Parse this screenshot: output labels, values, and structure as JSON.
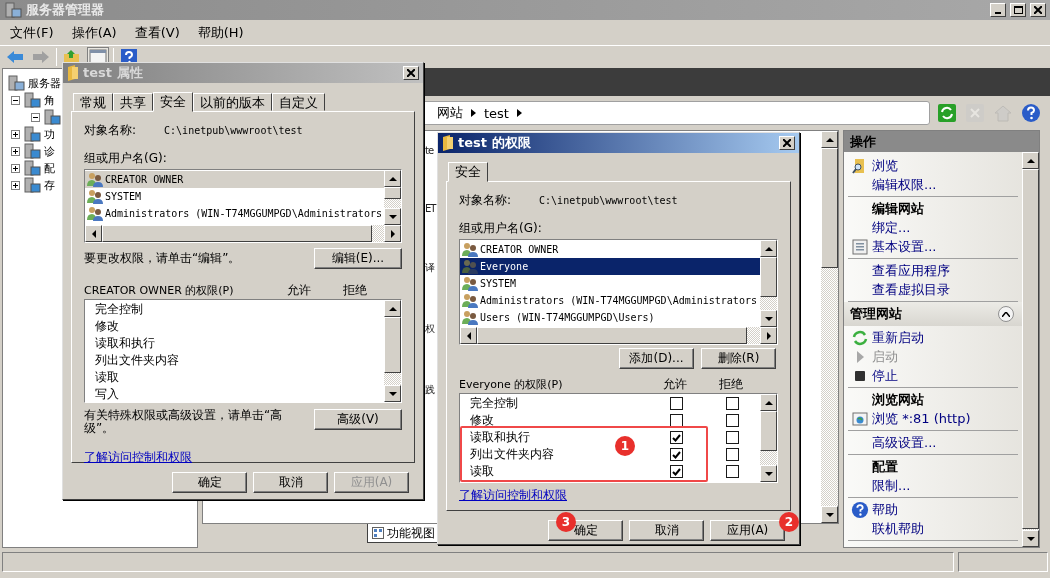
{
  "window": {
    "title": "服务器管理器"
  },
  "menu": [
    {
      "label": "文件(F)"
    },
    {
      "label": "操作(A)"
    },
    {
      "label": "查看(V)"
    },
    {
      "label": "帮助(H)"
    }
  ],
  "toolbar": {
    "back": {
      "disabled": false
    },
    "forward": {
      "disabled": true
    },
    "pane_toggle": {
      "pressed": true
    }
  },
  "tree": [
    {
      "label": "服务器",
      "children": [
        {
          "label": "角",
          "expanded": true,
          "children": [
            {
              "expanded": true
            }
          ]
        },
        {
          "label": "功",
          "expanded": false
        },
        {
          "label": "诊",
          "expanded": false
        },
        {
          "label": "配",
          "expanded": false
        },
        {
          "label": "存",
          "expanded": false
        }
      ]
    }
  ],
  "address_bar": {
    "crumbs": [
      "网站",
      "test"
    ]
  },
  "nav_tools": [
    {
      "kind": "refresh",
      "disabled": false
    },
    {
      "kind": "stop",
      "disabled": true
    },
    {
      "kind": "home",
      "disabled": true
    },
    {
      "kind": "help",
      "disabled": false
    }
  ],
  "center": {
    "fragments": [
      "te",
      "ET",
      "译",
      "权",
      "践"
    ],
    "view_tabs": [
      {
        "label": "功能视图",
        "selected": true
      }
    ]
  },
  "actions": {
    "title": "操作",
    "groups": [
      {
        "sections": [
          [
            {
              "kind": "browse",
              "label": "浏览",
              "disabled": false
            },
            {
              "kind": "link",
              "label": "编辑权限...",
              "disabled": false
            }
          ],
          [
            {
              "kind": "heading",
              "label": "编辑网站",
              "disabled": false
            },
            {
              "kind": "link",
              "label": "绑定...",
              "disabled": false
            },
            {
              "kind": "settings",
              "label": "基本设置...",
              "disabled": false
            }
          ],
          [
            {
              "kind": "link",
              "label": "查看应用程序",
              "disabled": false
            },
            {
              "kind": "link",
              "label": "查看虚拟目录",
              "disabled": false
            }
          ]
        ]
      },
      {
        "title": "管理网站",
        "expanded": true,
        "sections": [
          [
            {
              "kind": "restart",
              "label": "重新启动",
              "disabled": false
            },
            {
              "kind": "start",
              "label": "启动",
              "disabled": true
            },
            {
              "kind": "stop",
              "label": "停止",
              "disabled": false
            }
          ],
          [
            {
              "kind": "heading",
              "label": "浏览网站",
              "disabled": false
            },
            {
              "kind": "site",
              "label": "浏览 *:81 (http)",
              "disabled": false
            }
          ],
          [
            {
              "kind": "link",
              "label": "高级设置...",
              "disabled": false
            }
          ],
          [
            {
              "kind": "heading",
              "label": "配置",
              "disabled": false
            },
            {
              "kind": "link",
              "label": "限制...",
              "disabled": false
            }
          ],
          [
            {
              "kind": "help",
              "label": "帮助",
              "disabled": false
            },
            {
              "kind": "link",
              "label": "联机帮助",
              "disabled": false
            }
          ]
        ]
      }
    ]
  },
  "dialogs": [
    {
      "title": "test 属性",
      "active": false,
      "tabs": [
        {
          "label": "常规",
          "selected": false
        },
        {
          "label": "共享",
          "selected": false
        },
        {
          "label": "安全",
          "selected": true
        },
        {
          "label": "以前的版本",
          "selected": false
        },
        {
          "label": "自定义",
          "selected": false
        }
      ],
      "object_label": "对象名称:",
      "object_name": "C:\\inetpub\\wwwroot\\test",
      "users_label": "组或用户名(G):",
      "users": [
        {
          "name": "CREATOR OWNER",
          "selected": true
        },
        {
          "name": "SYSTEM",
          "selected": false
        },
        {
          "name": "Administrators (WIN-T74MGGUMPGD\\Administrators",
          "selected": false
        }
      ],
      "edit_row": {
        "text": "要更改权限，请单击“编辑”。",
        "button": "编辑(E)..."
      },
      "permissions_label": "CREATOR OWNER 的权限(P)",
      "allow_label": "允许",
      "deny_label": "拒绝",
      "permissions": [
        {
          "name": "完全控制"
        },
        {
          "name": "修改"
        },
        {
          "name": "读取和执行"
        },
        {
          "name": "列出文件夹内容"
        },
        {
          "name": "读取"
        },
        {
          "name": "写入"
        }
      ],
      "advanced_row": {
        "text": "有关特殊权限或高级设置，请单击“高级”。",
        "button": "高级(V)"
      },
      "link": "了解访问控制和权限",
      "buttons": [
        {
          "label": "确定",
          "disabled": false
        },
        {
          "label": "取消",
          "disabled": false
        },
        {
          "label": "应用(A)",
          "disabled": true
        }
      ]
    },
    {
      "title": "test 的权限",
      "active": true,
      "tabs": [
        {
          "label": "安全",
          "selected": true
        }
      ],
      "object_label": "对象名称:",
      "object_name": "C:\\inetpub\\wwwroot\\test",
      "users_label": "组或用户名(G):",
      "users": [
        {
          "name": "CREATOR OWNER",
          "selected": false
        },
        {
          "name": "Everyone",
          "selected": true
        },
        {
          "name": "SYSTEM",
          "selected": false
        },
        {
          "name": "Administrators (WIN-T74MGGUMPGD\\Administrators",
          "selected": false
        },
        {
          "name": "Users (WIN-T74MGGUMPGD\\Users)",
          "selected": false
        }
      ],
      "list_buttons": [
        {
          "label": "添加(D)..."
        },
        {
          "label": "删除(R)"
        }
      ],
      "permissions_label": "Everyone 的权限(P)",
      "allow_label": "允许",
      "deny_label": "拒绝",
      "permissions": [
        {
          "name": "完全控制",
          "allow": false,
          "deny": false
        },
        {
          "name": "修改",
          "allow": false,
          "deny": false
        },
        {
          "name": "读取和执行",
          "allow": true,
          "deny": false
        },
        {
          "name": "列出文件夹内容",
          "allow": true,
          "deny": false
        },
        {
          "name": "读取",
          "allow": true,
          "deny": false
        }
      ],
      "link": "了解访问控制和权限",
      "buttons": [
        {
          "label": "确定",
          "disabled": false
        },
        {
          "label": "取消",
          "disabled": false
        },
        {
          "label": "应用(A)",
          "disabled": false
        }
      ],
      "markers": [
        "1",
        "2",
        "3"
      ]
    }
  ]
}
